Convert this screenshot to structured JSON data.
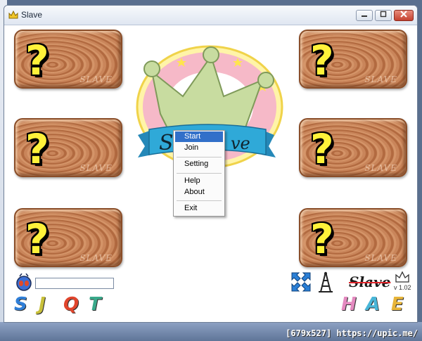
{
  "window": {
    "title": "Slave",
    "title_icon": "crown-icon"
  },
  "titlebar_buttons": [
    "minimize",
    "maximize",
    "close"
  ],
  "cards": [
    {
      "symbol": "?",
      "watermark": "SLAVE"
    },
    {
      "symbol": "?",
      "watermark": "SLAVE"
    },
    {
      "symbol": "?",
      "watermark": "SLAVE"
    },
    {
      "symbol": "?",
      "watermark": "SLAVE"
    },
    {
      "symbol": "?",
      "watermark": "SLAVE"
    },
    {
      "symbol": "?",
      "watermark": "SLAVE"
    }
  ],
  "logo": {
    "text_fragment": "e",
    "text_fragment2": "ve"
  },
  "context_menu": {
    "items": [
      "Start",
      "Join",
      "Setting",
      "Help",
      "About",
      "Exit"
    ],
    "selected": "Start"
  },
  "bottom": {
    "name_input_value": "",
    "letters_left": [
      "S",
      "J",
      "Q",
      "T"
    ],
    "letters_right": [
      "H",
      "A",
      "E"
    ],
    "brand": "Slave",
    "version": "v 1.02"
  },
  "watermark": "[679x527] https://upic.me/",
  "colors": {
    "card_wood": "#b8703f",
    "question_mark": "#fff23a",
    "menu_highlight": "#3270c9",
    "crown_green": "#c8dca0",
    "banner_blue": "#2fa9d8",
    "letter_S": "#2f7fd8",
    "letter_J": "#c8c03a",
    "letter_Q": "#e0452c",
    "letter_T": "#3aa98a",
    "letter_H": "#e48ac0",
    "letter_A": "#49b6d8",
    "letter_E": "#e8b53a"
  }
}
